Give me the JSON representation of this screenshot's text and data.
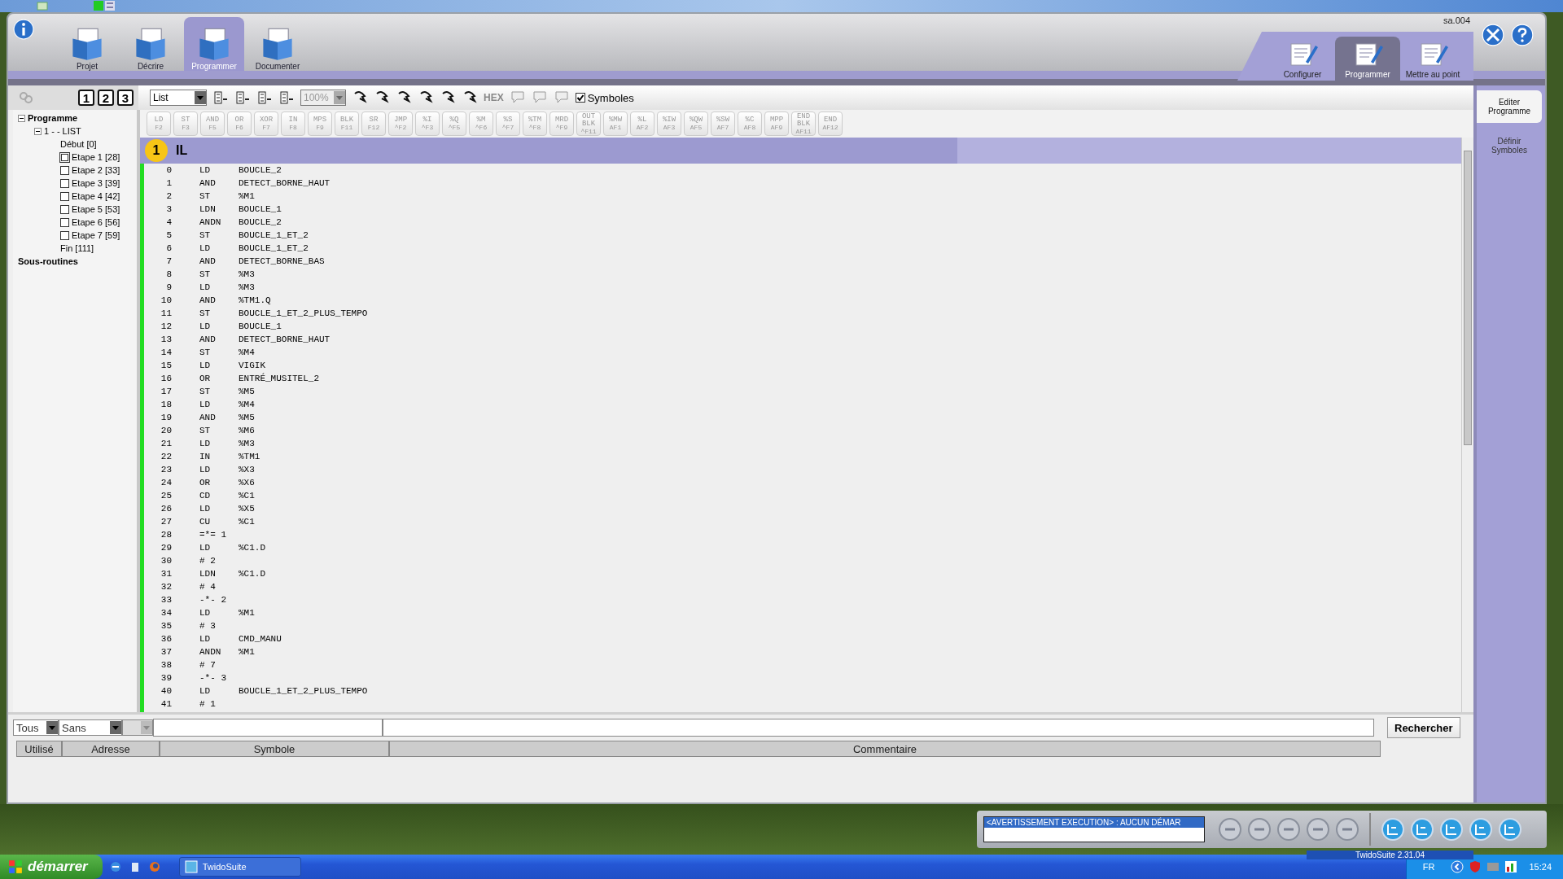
{
  "window": {
    "project_code": "sa.004"
  },
  "main_tabs": [
    {
      "label": "Projet",
      "selected": false
    },
    {
      "label": "Décrire",
      "selected": false
    },
    {
      "label": "Programmer",
      "selected": true
    },
    {
      "label": "Documenter",
      "selected": false
    }
  ],
  "sub_tabs": [
    {
      "label": "Configurer",
      "selected": false
    },
    {
      "label": "Programmer",
      "selected": true
    },
    {
      "label": "Mettre au point",
      "selected": false
    }
  ],
  "tree_toolbar": {
    "view_buttons": [
      "1",
      "2",
      "3"
    ]
  },
  "editor_toolbar": {
    "language": "List",
    "zoom": "100%",
    "hex": "HEX",
    "symbols": {
      "label": "Symboles",
      "checked": true
    }
  },
  "instruction_keys": [
    {
      "label": "LD",
      "key": "F2"
    },
    {
      "label": "ST",
      "key": "F3"
    },
    {
      "label": "AND",
      "key": "F5"
    },
    {
      "label": "OR",
      "key": "F6"
    },
    {
      "label": "XOR",
      "key": "F7"
    },
    {
      "label": "IN",
      "key": "F8"
    },
    {
      "label": "MPS",
      "key": "F9"
    },
    {
      "label": "BLK",
      "key": "F11"
    },
    {
      "label": "SR",
      "key": "F12"
    },
    {
      "label": "JMP",
      "key": "^F2"
    },
    {
      "label": "%I",
      "key": "^F3"
    },
    {
      "label": "%Q",
      "key": "^F5"
    },
    {
      "label": "%M",
      "key": "^F6"
    },
    {
      "label": "%S",
      "key": "^F7"
    },
    {
      "label": "%TM",
      "key": "^F8"
    },
    {
      "label": "MRD",
      "key": "^F9"
    },
    {
      "label": "OUT BLK",
      "key": "^F11"
    },
    {
      "label": "%MW",
      "key": "AF1"
    },
    {
      "label": "%L",
      "key": "AF2"
    },
    {
      "label": "%IW",
      "key": "AF3"
    },
    {
      "label": "%QW",
      "key": "AF5"
    },
    {
      "label": "%SW",
      "key": "AF7"
    },
    {
      "label": "%C",
      "key": "AF8"
    },
    {
      "label": "MPP",
      "key": "AF9"
    },
    {
      "label": "END BLK",
      "key": "AF11"
    },
    {
      "label": "END",
      "key": "AF12"
    }
  ],
  "tree": [
    {
      "label": "Programme",
      "expanded": true,
      "children": [
        {
          "label": "1 -  - LIST",
          "expanded": true,
          "children": [
            {
              "label": "Début [0]",
              "kind": "leaf",
              "selected": false
            },
            {
              "label": "Etape 1 [28]",
              "kind": "step",
              "selected": true
            },
            {
              "label": "Etape 2 [33]",
              "kind": "step",
              "selected": false
            },
            {
              "label": "Etape 3 [39]",
              "kind": "step",
              "selected": false
            },
            {
              "label": "Etape 4 [42]",
              "kind": "step",
              "selected": false
            },
            {
              "label": "Etape 5 [53]",
              "kind": "step",
              "selected": false
            },
            {
              "label": "Etape 6 [56]",
              "kind": "step",
              "selected": false
            },
            {
              "label": "Etape 7 [59]",
              "kind": "step",
              "selected": false
            },
            {
              "label": "Fin [111]",
              "kind": "leaf",
              "selected": false
            }
          ]
        }
      ]
    },
    {
      "label": "Sous-routines"
    }
  ],
  "rung": {
    "number": "1",
    "language": "IL"
  },
  "program_lines": [
    {
      "n": "0",
      "op": "LD",
      "operand": "BOUCLE_2"
    },
    {
      "n": "1",
      "op": "AND",
      "operand": "DETECT_BORNE_HAUT"
    },
    {
      "n": "2",
      "op": "ST",
      "operand": "%M1"
    },
    {
      "n": "3",
      "op": "LDN",
      "operand": "BOUCLE_1"
    },
    {
      "n": "4",
      "op": "ANDN",
      "operand": "BOUCLE_2"
    },
    {
      "n": "5",
      "op": "ST",
      "operand": "BOUCLE_1_ET_2"
    },
    {
      "n": "6",
      "op": "LD",
      "operand": "BOUCLE_1_ET_2"
    },
    {
      "n": "7",
      "op": "AND",
      "operand": "DETECT_BORNE_BAS"
    },
    {
      "n": "8",
      "op": "ST",
      "operand": "%M3"
    },
    {
      "n": "9",
      "op": "LD",
      "operand": "%M3"
    },
    {
      "n": "10",
      "op": "AND",
      "operand": "%TM1.Q"
    },
    {
      "n": "11",
      "op": "ST",
      "operand": "BOUCLE_1_ET_2_PLUS_TEMPO"
    },
    {
      "n": "12",
      "op": "LD",
      "operand": "BOUCLE_1"
    },
    {
      "n": "13",
      "op": "AND",
      "operand": "DETECT_BORNE_HAUT"
    },
    {
      "n": "14",
      "op": "ST",
      "operand": "%M4"
    },
    {
      "n": "15",
      "op": "LD",
      "operand": "VIGIK"
    },
    {
      "n": "16",
      "op": "OR",
      "operand": "ENTRÉ_MUSITEL_2"
    },
    {
      "n": "17",
      "op": "ST",
      "operand": "%M5"
    },
    {
      "n": "18",
      "op": "LD",
      "operand": "%M4"
    },
    {
      "n": "19",
      "op": "AND",
      "operand": "%M5"
    },
    {
      "n": "20",
      "op": "ST",
      "operand": "%M6"
    },
    {
      "n": "21",
      "op": "LD",
      "operand": "%M3"
    },
    {
      "n": "22",
      "op": "IN",
      "operand": "%TM1"
    },
    {
      "n": "23",
      "op": "LD",
      "operand": "%X3"
    },
    {
      "n": "24",
      "op": "OR",
      "operand": "%X6"
    },
    {
      "n": "25",
      "op": "CD",
      "operand": "%C1"
    },
    {
      "n": "26",
      "op": "LD",
      "operand": "%X5"
    },
    {
      "n": "27",
      "op": "CU",
      "operand": "%C1"
    },
    {
      "n": "28",
      "op": "=*= 1"
    },
    {
      "n": "29",
      "op": "LD",
      "operand": "%C1.D"
    },
    {
      "n": "30",
      "op": "# 2"
    },
    {
      "n": "31",
      "op": "LDN",
      "operand": "%C1.D"
    },
    {
      "n": "32",
      "op": "# 4"
    },
    {
      "n": "33",
      "op": "-*- 2"
    },
    {
      "n": "34",
      "op": "LD",
      "operand": "%M1"
    },
    {
      "n": "35",
      "op": "# 3"
    },
    {
      "n": "36",
      "op": "LD",
      "operand": "CMD_MANU"
    },
    {
      "n": "37",
      "op": "ANDN",
      "operand": "%M1"
    },
    {
      "n": "38",
      "op": "# 7"
    },
    {
      "n": "39",
      "op": "-*- 3"
    },
    {
      "n": "40",
      "op": "LD",
      "operand": "BOUCLE_1_ET_2_PLUS_TEMPO"
    },
    {
      "n": "41",
      "op": "# 1"
    }
  ],
  "side_tabs": [
    {
      "label": "Editer Programme",
      "selected": true
    },
    {
      "label": "Définir Symboles",
      "selected": false
    }
  ],
  "symbol_table": {
    "filters": [
      "Tous",
      "Sans"
    ],
    "search_button": "Rechercher",
    "columns": [
      "Utilisé",
      "Adresse",
      "Symbole",
      "Commentaire"
    ]
  },
  "status": {
    "message": "<AVERTISSEMENT EXECUTION> :  AUCUN DÉMAR",
    "version": "TwidoSuite 2.31.04"
  },
  "taskbar": {
    "start": "démarrer",
    "tasks": [
      "TwidoSuite"
    ],
    "language": "FR",
    "clock": "15:24"
  }
}
